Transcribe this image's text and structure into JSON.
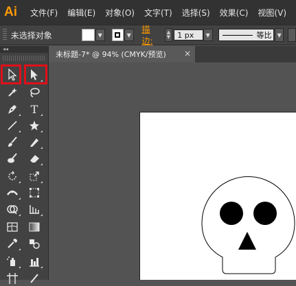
{
  "app": {
    "logo": "Ai"
  },
  "menu": {
    "items": [
      "文件(F)",
      "编辑(E)",
      "对象(O)",
      "文字(T)",
      "选择(S)",
      "效果(C)",
      "视图(V)"
    ]
  },
  "controlbar": {
    "selection_status": "未选择对象",
    "stroke_label": "描边:",
    "stroke_weight": "1 px",
    "profile_label": "等比"
  },
  "tab": {
    "title": "未标题-7* @ 94% (CMYK/预览)",
    "close": "×"
  },
  "toolpanel": {
    "collapse": "◂◂"
  },
  "tools": [
    {
      "name": "selection-tool"
    },
    {
      "name": "direct-selection-tool"
    },
    {
      "name": "magic-wand-tool"
    },
    {
      "name": "lasso-tool"
    },
    {
      "name": "pen-tool"
    },
    {
      "name": "type-tool",
      "glyph": "T"
    },
    {
      "name": "line-segment-tool"
    },
    {
      "name": "star-tool"
    },
    {
      "name": "paintbrush-tool"
    },
    {
      "name": "pencil-tool"
    },
    {
      "name": "blob-brush-tool"
    },
    {
      "name": "eraser-tool"
    },
    {
      "name": "rotate-tool"
    },
    {
      "name": "scale-tool"
    },
    {
      "name": "width-tool"
    },
    {
      "name": "free-transform-tool"
    },
    {
      "name": "shape-builder-tool"
    },
    {
      "name": "graph-tool"
    },
    {
      "name": "mesh-tool"
    },
    {
      "name": "gradient-tool"
    },
    {
      "name": "eyedropper-tool"
    },
    {
      "name": "blend-tool"
    },
    {
      "name": "symbol-sprayer-tool"
    },
    {
      "name": "column-graph-tool"
    }
  ],
  "colors": {
    "accent": "#ff9a00",
    "highlight": "#e0101a",
    "canvas": "#535353"
  }
}
